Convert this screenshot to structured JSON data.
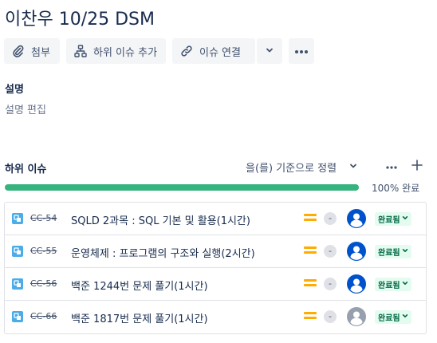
{
  "issue": {
    "title": "이찬우 10/25 DSM"
  },
  "toolbar": {
    "attach_label": "첨부",
    "add_child_label": "하위 이슈 추가",
    "link_label": "이슈 연결"
  },
  "description": {
    "label": "설명",
    "placeholder": "설명 편집"
  },
  "child_issues": {
    "label": "하위 이슈",
    "sort_label": "을(를) 기준으로 정렬",
    "progress_percent": 100,
    "progress_text": "100% 완료",
    "items": [
      {
        "key": "CC-54",
        "summary": "SQLD 2과목 : SQL 기본 및 활용(1시간)",
        "estimate": "-",
        "status": "완료됨",
        "avatar_color": "#0052cc"
      },
      {
        "key": "CC-55",
        "summary": "운영체제 : 프로그램의 구조와 실행(2시간)",
        "estimate": "-",
        "status": "완료됨",
        "avatar_color": "#0052cc"
      },
      {
        "key": "CC-56",
        "summary": "백준 1244번 문제 풀기(1시간)",
        "estimate": "-",
        "status": "완료됨",
        "avatar_color": "#0052cc"
      },
      {
        "key": "CC-66",
        "summary": "백준 1817번 문제 풀기(1시간)",
        "estimate": "-",
        "status": "완료됨",
        "avatar_color": "#97a0af"
      }
    ]
  },
  "colors": {
    "progress": "#36b37e",
    "priority_medium": "#ffab00",
    "task_icon": "#4bade8",
    "status_done_bg": "#e3fcef",
    "status_done_text": "#006644"
  }
}
